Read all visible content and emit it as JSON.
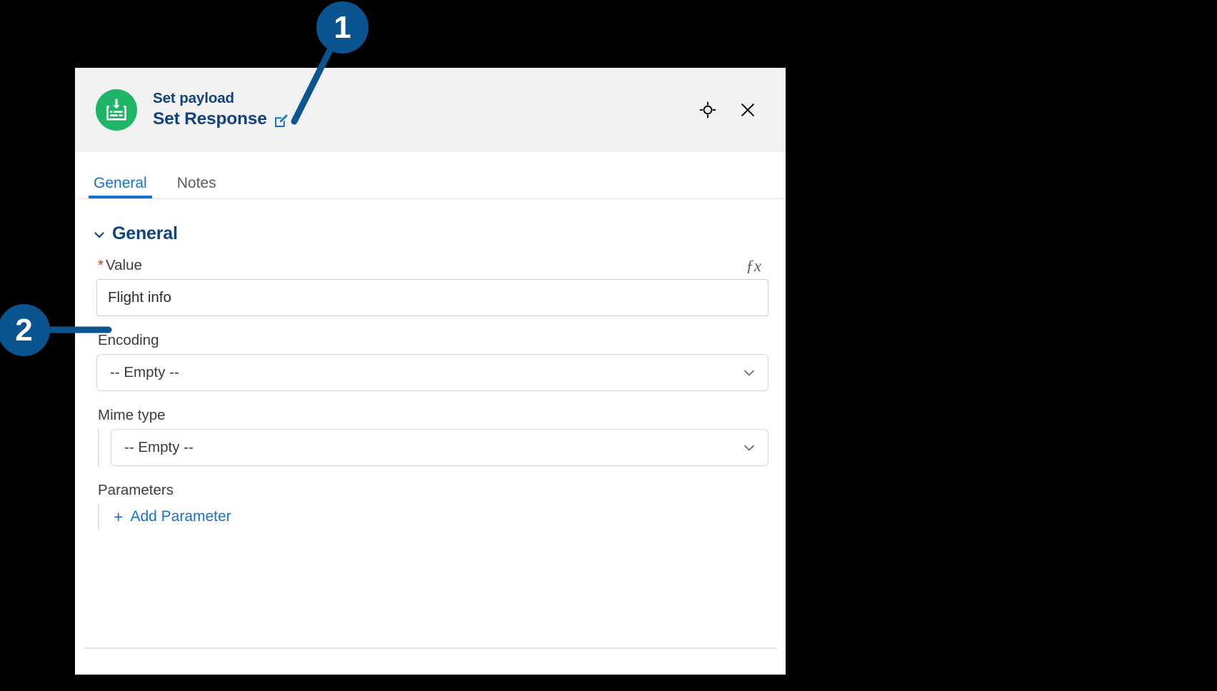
{
  "panel": {
    "header": {
      "node_icon": "set-payload-icon",
      "node_type": "Set payload",
      "node_name": "Set Response",
      "edit_icon": "edit-pencil-icon",
      "focus_icon": "focus-crosshair-icon",
      "close_icon": "close-x-icon"
    },
    "tabs": [
      {
        "label": "General",
        "active": true
      },
      {
        "label": "Notes",
        "active": false
      }
    ],
    "section": {
      "title": "General",
      "collapse_icon": "chevron-down-icon"
    },
    "fields": {
      "value": {
        "label": "Value",
        "required_marker": "*",
        "fx_label": "ƒx",
        "value": "Flight info",
        "placeholder": ""
      },
      "encoding": {
        "label": "Encoding",
        "selected": "-- Empty --",
        "chevron": "chevron-down-icon"
      },
      "mime_type": {
        "label": "Mime type",
        "selected": "-- Empty --",
        "chevron": "chevron-down-icon"
      },
      "parameters": {
        "label": "Parameters",
        "add_plus": "+",
        "add_label": "Add Parameter"
      }
    }
  },
  "callouts": [
    {
      "number": "1"
    },
    {
      "number": "2"
    }
  ],
  "colors": {
    "accent_blue": "#1672cd",
    "title_navy": "#11437f",
    "callout_blue": "#0a5490",
    "node_green": "#1eb567",
    "required_red": "#de3618",
    "header_gray": "#f2f2f2"
  }
}
